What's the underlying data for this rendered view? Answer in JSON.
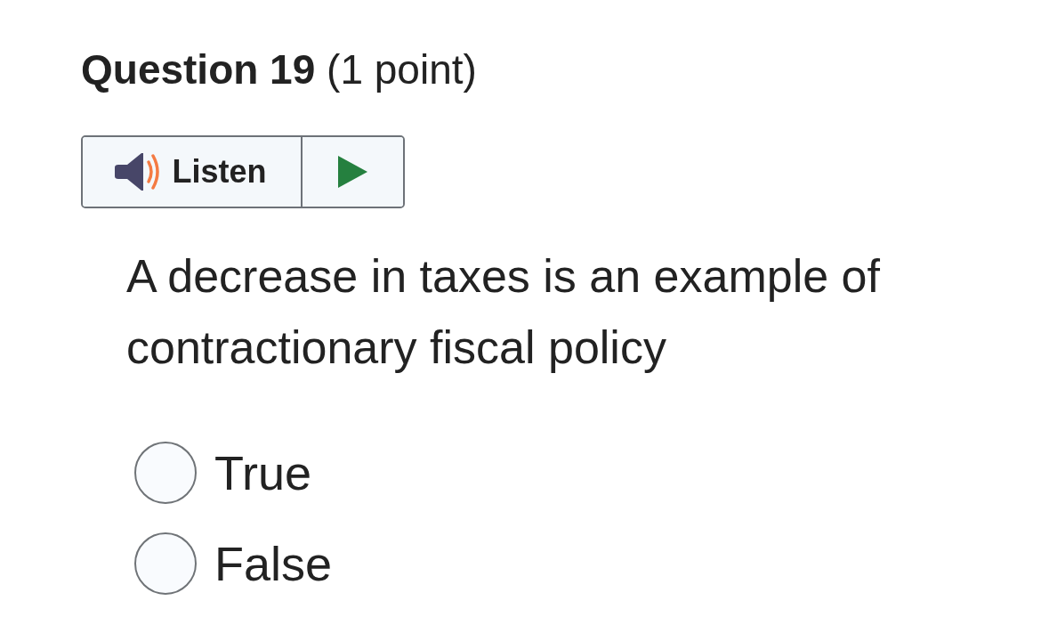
{
  "title": "**Question 19** (1 point)",
  "listen": {
    "label": "Listen"
  },
  "prompt": "A decrease in taxes is an example of contractionary fiscal policy",
  "options": [
    {
      "label": "True",
      "selected": false
    },
    {
      "label": "False",
      "selected": false
    }
  ]
}
